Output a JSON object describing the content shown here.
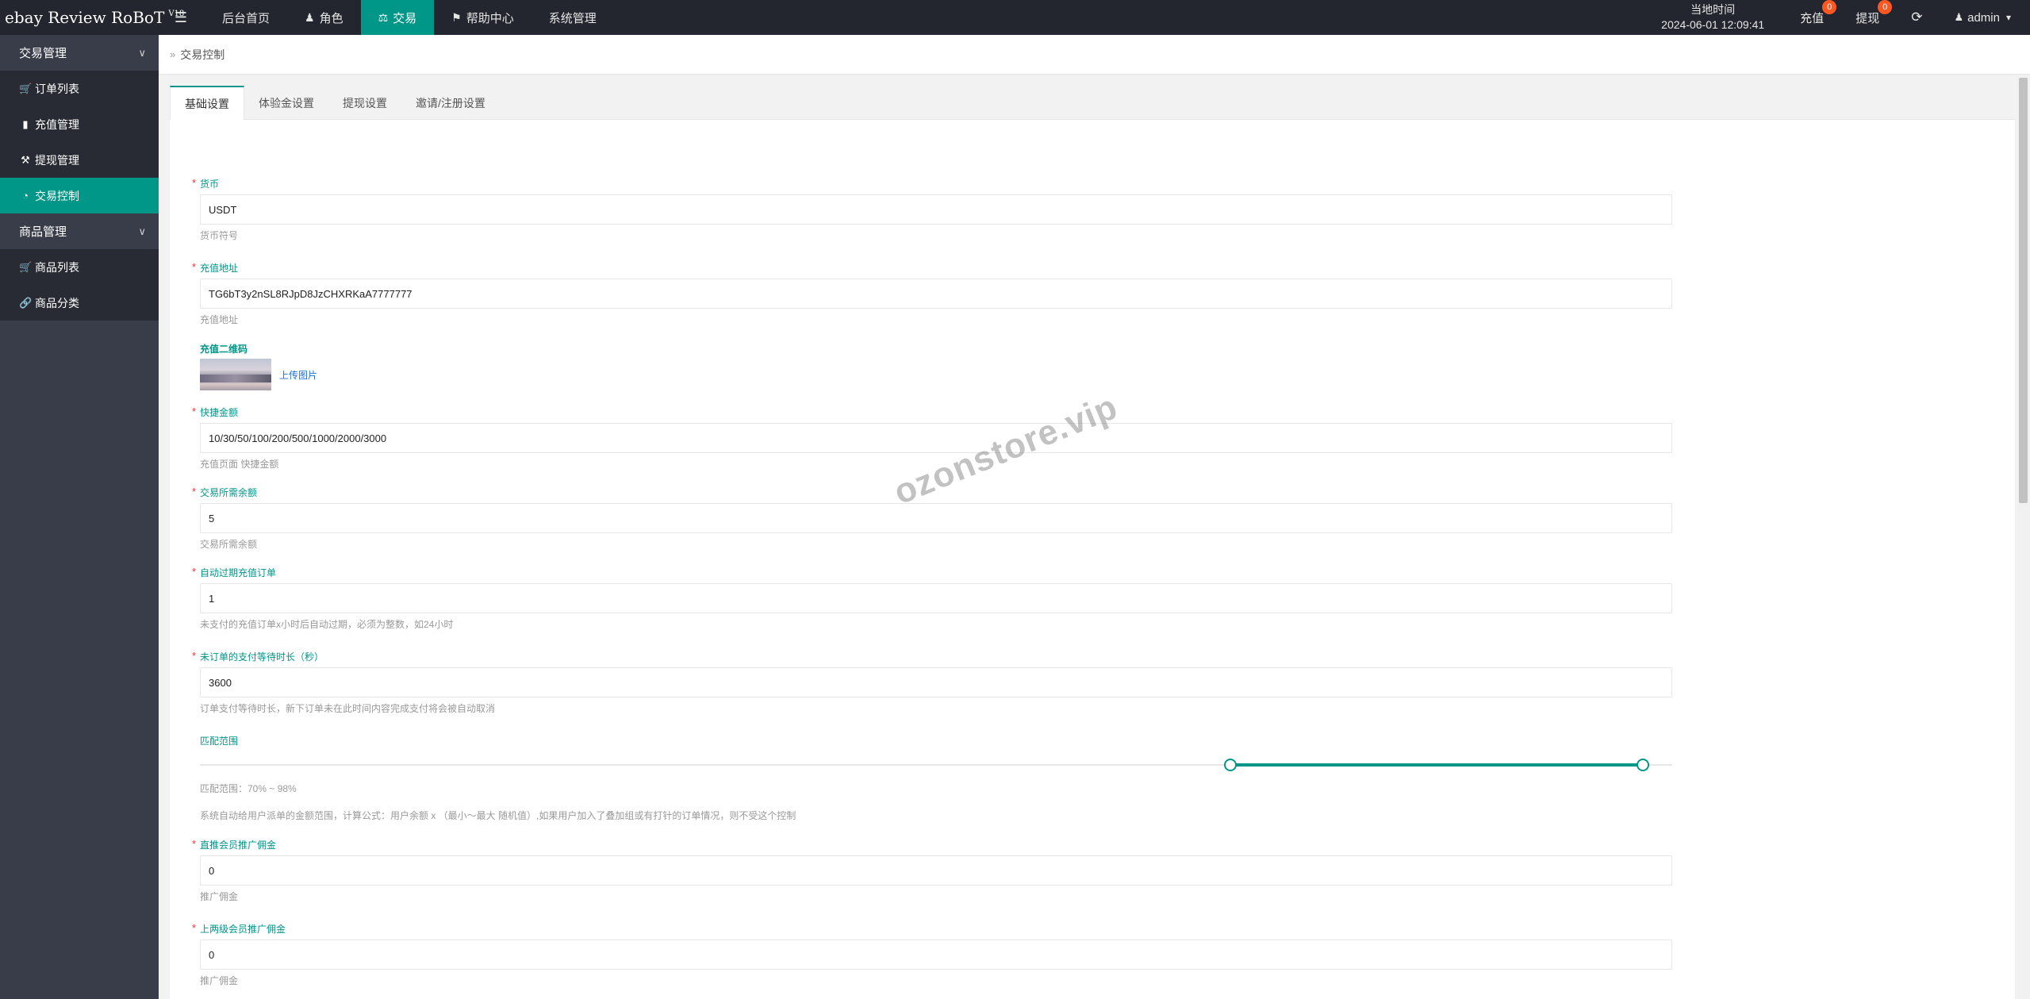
{
  "app": {
    "title": "ebay Review RoBoT",
    "version": "V18"
  },
  "topnav": {
    "items": [
      {
        "label": "后台首页",
        "icon": ""
      },
      {
        "label": "角色",
        "icon": "user-icon"
      },
      {
        "label": "交易",
        "icon": "scale-icon",
        "active": true
      },
      {
        "label": "帮助中心",
        "icon": "flag-icon"
      },
      {
        "label": "系统管理",
        "icon": ""
      }
    ]
  },
  "header": {
    "time_label": "当地时间",
    "time_value": "2024-06-01 12:09:41",
    "recharge_label": "充值",
    "recharge_count": "0",
    "withdraw_label": "提现",
    "withdraw_count": "0",
    "user": "admin"
  },
  "sidebar": {
    "groups": [
      {
        "label": "交易管理",
        "items": [
          {
            "label": "订单列表",
            "icon": "cart-icon"
          },
          {
            "label": "充值管理",
            "icon": "chat-icon"
          },
          {
            "label": "提现管理",
            "icon": "hammer-icon"
          },
          {
            "label": "交易控制",
            "icon": "gauge-icon",
            "active": true
          }
        ]
      },
      {
        "label": "商品管理",
        "items": [
          {
            "label": "商品列表",
            "icon": "cart-icon"
          },
          {
            "label": "商品分类",
            "icon": "link-icon"
          }
        ]
      }
    ]
  },
  "breadcrumb": {
    "current": "交易控制"
  },
  "tabs": [
    "基础设置",
    "体验金设置",
    "提现设置",
    "邀请/注册设置"
  ],
  "form": {
    "currency": {
      "label": "货币",
      "value": "USDT",
      "help": "货币符号"
    },
    "recharge_address": {
      "label": "充值地址",
      "value": "TG6bT3y2nSL8RJpD8JzCHXRKaA7777777",
      "help": "充值地址"
    },
    "qr_code": {
      "label": "充值二维码",
      "upload_label": "上传图片"
    },
    "quick_amount": {
      "label": "快捷金额",
      "value": "10/30/50/100/200/500/1000/2000/3000",
      "help": "充值页面 快捷金额"
    },
    "min_balance": {
      "label": "交易所需余额",
      "value": "5",
      "help": "交易所需余额"
    },
    "auto_expire": {
      "label": "自动过期充值订单",
      "value": "1",
      "help": "未支付的充值订单x小时后自动过期，必须为整数，如24小时"
    },
    "pay_wait": {
      "label": "未订单的支付等待时长（秒）",
      "value": "3600",
      "help": "订单支付等待时长，新下订单未在此时间内容完成支付将会被自动取消"
    },
    "match_range": {
      "label": "匹配范围",
      "min": 70,
      "max": 98,
      "help": "匹配范围：70% ~ 98%",
      "note": "系统自动给用户派单的金额范围，计算公式：用户余额 x （最小～最大 随机值）,如果用户加入了叠加组或有打针的订单情况，则不受这个控制"
    },
    "direct_commission": {
      "label": "直推会员推广佣金",
      "value": "0",
      "help": "推广佣金"
    },
    "level2_commission": {
      "label": "上两级会员推广佣金",
      "value": "0",
      "help": "推广佣金"
    }
  },
  "watermark": "ozonstore.vip",
  "colors": {
    "accent": "#009688",
    "header": "#23262e",
    "sidebar": "#393d49",
    "badge": "#ff5722"
  }
}
